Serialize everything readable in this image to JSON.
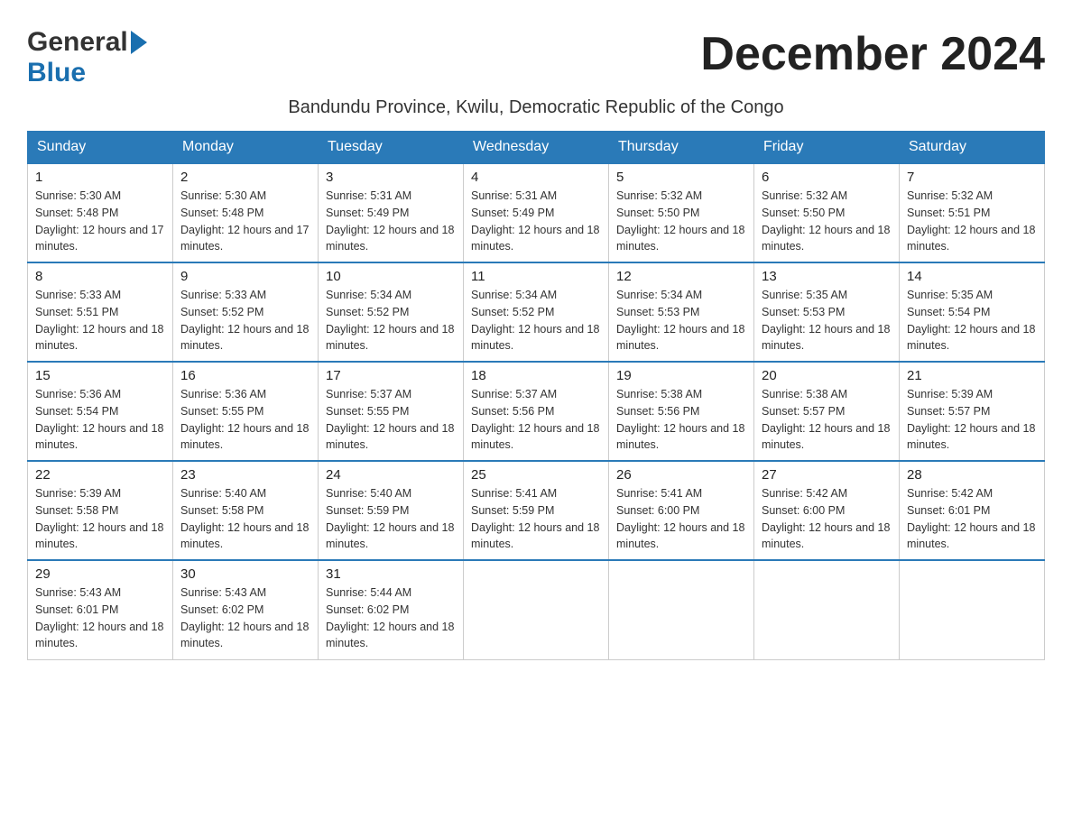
{
  "header": {
    "logo_general": "General",
    "logo_blue": "Blue",
    "month_title": "December 2024",
    "subtitle": "Bandundu Province, Kwilu, Democratic Republic of the Congo"
  },
  "weekdays": [
    "Sunday",
    "Monday",
    "Tuesday",
    "Wednesday",
    "Thursday",
    "Friday",
    "Saturday"
  ],
  "weeks": [
    [
      {
        "day": "1",
        "sunrise": "5:30 AM",
        "sunset": "5:48 PM",
        "daylight": "12 hours and 17 minutes."
      },
      {
        "day": "2",
        "sunrise": "5:30 AM",
        "sunset": "5:48 PM",
        "daylight": "12 hours and 17 minutes."
      },
      {
        "day": "3",
        "sunrise": "5:31 AM",
        "sunset": "5:49 PM",
        "daylight": "12 hours and 18 minutes."
      },
      {
        "day": "4",
        "sunrise": "5:31 AM",
        "sunset": "5:49 PM",
        "daylight": "12 hours and 18 minutes."
      },
      {
        "day": "5",
        "sunrise": "5:32 AM",
        "sunset": "5:50 PM",
        "daylight": "12 hours and 18 minutes."
      },
      {
        "day": "6",
        "sunrise": "5:32 AM",
        "sunset": "5:50 PM",
        "daylight": "12 hours and 18 minutes."
      },
      {
        "day": "7",
        "sunrise": "5:32 AM",
        "sunset": "5:51 PM",
        "daylight": "12 hours and 18 minutes."
      }
    ],
    [
      {
        "day": "8",
        "sunrise": "5:33 AM",
        "sunset": "5:51 PM",
        "daylight": "12 hours and 18 minutes."
      },
      {
        "day": "9",
        "sunrise": "5:33 AM",
        "sunset": "5:52 PM",
        "daylight": "12 hours and 18 minutes."
      },
      {
        "day": "10",
        "sunrise": "5:34 AM",
        "sunset": "5:52 PM",
        "daylight": "12 hours and 18 minutes."
      },
      {
        "day": "11",
        "sunrise": "5:34 AM",
        "sunset": "5:52 PM",
        "daylight": "12 hours and 18 minutes."
      },
      {
        "day": "12",
        "sunrise": "5:34 AM",
        "sunset": "5:53 PM",
        "daylight": "12 hours and 18 minutes."
      },
      {
        "day": "13",
        "sunrise": "5:35 AM",
        "sunset": "5:53 PM",
        "daylight": "12 hours and 18 minutes."
      },
      {
        "day": "14",
        "sunrise": "5:35 AM",
        "sunset": "5:54 PM",
        "daylight": "12 hours and 18 minutes."
      }
    ],
    [
      {
        "day": "15",
        "sunrise": "5:36 AM",
        "sunset": "5:54 PM",
        "daylight": "12 hours and 18 minutes."
      },
      {
        "day": "16",
        "sunrise": "5:36 AM",
        "sunset": "5:55 PM",
        "daylight": "12 hours and 18 minutes."
      },
      {
        "day": "17",
        "sunrise": "5:37 AM",
        "sunset": "5:55 PM",
        "daylight": "12 hours and 18 minutes."
      },
      {
        "day": "18",
        "sunrise": "5:37 AM",
        "sunset": "5:56 PM",
        "daylight": "12 hours and 18 minutes."
      },
      {
        "day": "19",
        "sunrise": "5:38 AM",
        "sunset": "5:56 PM",
        "daylight": "12 hours and 18 minutes."
      },
      {
        "day": "20",
        "sunrise": "5:38 AM",
        "sunset": "5:57 PM",
        "daylight": "12 hours and 18 minutes."
      },
      {
        "day": "21",
        "sunrise": "5:39 AM",
        "sunset": "5:57 PM",
        "daylight": "12 hours and 18 minutes."
      }
    ],
    [
      {
        "day": "22",
        "sunrise": "5:39 AM",
        "sunset": "5:58 PM",
        "daylight": "12 hours and 18 minutes."
      },
      {
        "day": "23",
        "sunrise": "5:40 AM",
        "sunset": "5:58 PM",
        "daylight": "12 hours and 18 minutes."
      },
      {
        "day": "24",
        "sunrise": "5:40 AM",
        "sunset": "5:59 PM",
        "daylight": "12 hours and 18 minutes."
      },
      {
        "day": "25",
        "sunrise": "5:41 AM",
        "sunset": "5:59 PM",
        "daylight": "12 hours and 18 minutes."
      },
      {
        "day": "26",
        "sunrise": "5:41 AM",
        "sunset": "6:00 PM",
        "daylight": "12 hours and 18 minutes."
      },
      {
        "day": "27",
        "sunrise": "5:42 AM",
        "sunset": "6:00 PM",
        "daylight": "12 hours and 18 minutes."
      },
      {
        "day": "28",
        "sunrise": "5:42 AM",
        "sunset": "6:01 PM",
        "daylight": "12 hours and 18 minutes."
      }
    ],
    [
      {
        "day": "29",
        "sunrise": "5:43 AM",
        "sunset": "6:01 PM",
        "daylight": "12 hours and 18 minutes."
      },
      {
        "day": "30",
        "sunrise": "5:43 AM",
        "sunset": "6:02 PM",
        "daylight": "12 hours and 18 minutes."
      },
      {
        "day": "31",
        "sunrise": "5:44 AM",
        "sunset": "6:02 PM",
        "daylight": "12 hours and 18 minutes."
      },
      null,
      null,
      null,
      null
    ]
  ]
}
